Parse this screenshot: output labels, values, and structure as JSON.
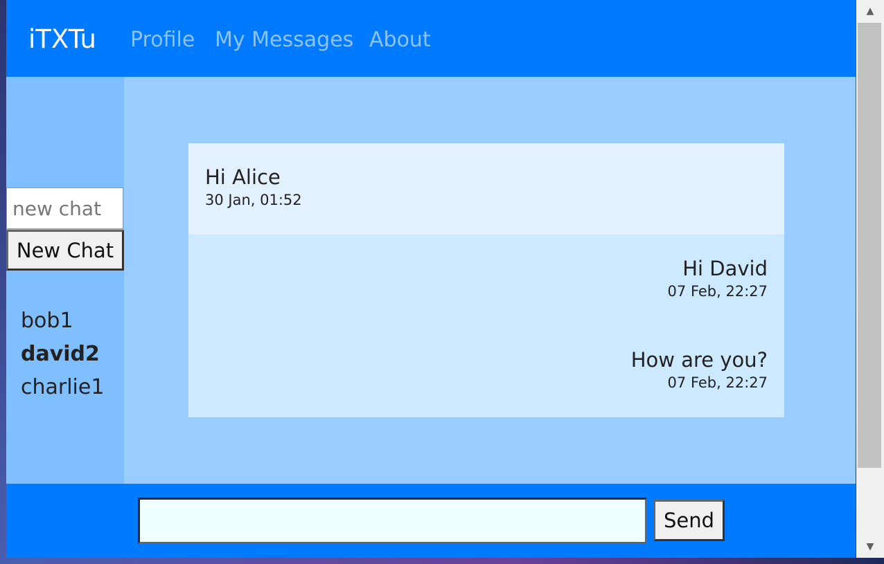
{
  "nav": {
    "brand": "iTXTu",
    "links": [
      "Profile",
      "My Messages",
      "About"
    ]
  },
  "sidebar": {
    "new_chat_placeholder": "new chat",
    "new_chat_button": "New Chat",
    "contacts": [
      {
        "name": "bob1",
        "active": false
      },
      {
        "name": "david2",
        "active": true
      },
      {
        "name": "charlie1",
        "active": false
      }
    ]
  },
  "messages": [
    {
      "text": "Hi Alice",
      "time": "30 Jan, 01:52",
      "direction": "incoming"
    },
    {
      "text": "Hi David",
      "time": "07 Feb, 22:27",
      "direction": "outgoing"
    },
    {
      "text": "How are you?",
      "time": "07 Feb, 22:27",
      "direction": "outgoing"
    }
  ],
  "footer": {
    "message_value": "",
    "send_button": "Send"
  },
  "scrollbar": {
    "up_icon": "arrow-up-icon",
    "down_icon": "arrow-down-icon"
  },
  "colors": {
    "navbar": "#007bff",
    "page_background": "#99ccff",
    "sidebar": "#7fbfff",
    "incoming_message": "#e3f1ff",
    "outgoing_message": "#cce9ff",
    "message_input": "#f0ffff"
  }
}
